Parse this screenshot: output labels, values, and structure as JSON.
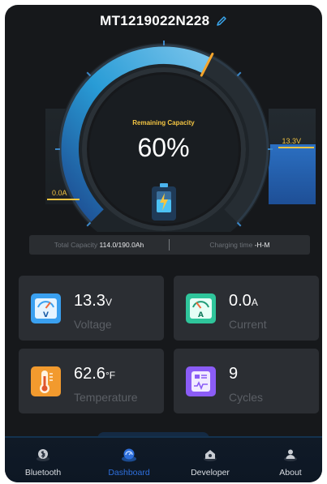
{
  "header": {
    "device_name": "MT1219022N228"
  },
  "gauge": {
    "label": "Remaining Capacity",
    "value_text": "60%",
    "level_percent": 60,
    "current_label": "0.0A",
    "voltage_label": "13.3V"
  },
  "info_bar": {
    "total_capacity_label": "Total Capacity",
    "total_capacity_value": "114.0/190.0Ah",
    "charging_time_label": "Charging time",
    "charging_time_value": "-H-M"
  },
  "cards": [
    {
      "value": "13.3",
      "unit": "V",
      "label": "Voltage",
      "icon": "voltmeter-icon",
      "color": "#3aa0f0"
    },
    {
      "value": "0.0",
      "unit": "A",
      "label": "Current",
      "icon": "ammeter-icon",
      "color": "#2fc59b"
    },
    {
      "value": "62.6",
      "unit": "°F",
      "label": "Temperature",
      "icon": "thermometer-icon",
      "color": "#f29a2e"
    },
    {
      "value": "9",
      "unit": "",
      "label": "Cycles",
      "icon": "cycles-icon",
      "color": "#8b5cf6"
    }
  ],
  "nav": [
    {
      "label": "Bluetooth",
      "icon": "bluetooth-icon"
    },
    {
      "label": "Dashboard",
      "icon": "dashboard-icon",
      "active": true
    },
    {
      "label": "Developer",
      "icon": "developer-icon"
    },
    {
      "label": "About",
      "icon": "about-icon"
    }
  ],
  "colors": {
    "accent": "#2e6fdc",
    "gauge_arc": "#29a8e8",
    "highlight": "#f4c542"
  }
}
